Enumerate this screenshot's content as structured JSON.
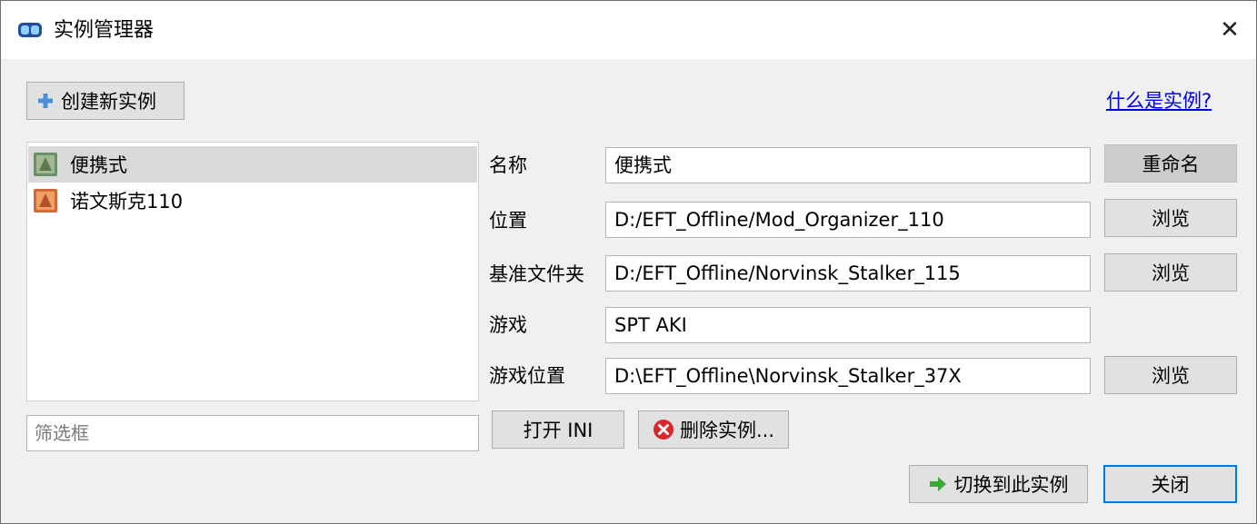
{
  "window": {
    "title": "实例管理器",
    "close_glyph": "✕"
  },
  "toolbar": {
    "create_label": "创建新实例",
    "help_link": "什么是实例?"
  },
  "instances": [
    {
      "name": "便携式",
      "selected": true
    },
    {
      "name": "诺文斯克110",
      "selected": false
    }
  ],
  "filter": {
    "placeholder": "筛选框",
    "value": ""
  },
  "form": {
    "name_label": "名称",
    "name_value": "便携式",
    "rename_label": "重命名",
    "location_label": "位置",
    "location_value": "D:/EFT_Offline/Mod_Organizer_110",
    "base_dir_label": "基准文件夹",
    "base_dir_value": "D:/EFT_Offline/Norvinsk_Stalker_115",
    "game_label": "游戏",
    "game_value": "SPT AKI",
    "game_location_label": "游戏位置",
    "game_location_value": "D:\\EFT_Offline\\Norvinsk_Stalker_37X",
    "browse_label": "浏览"
  },
  "actions": {
    "open_ini_label": "打开 INI",
    "delete_label": "删除实例...",
    "switch_label": "切换到此实例",
    "close_label": "关闭"
  },
  "colors": {
    "accent": "#0078d7",
    "link": "#0000ee",
    "selection": "#d9d9d9",
    "delete_icon": "#d9262c",
    "switch_icon": "#3aa935",
    "create_icon": "#4a90d9"
  },
  "icons": {
    "app": "mod-organizer-icon",
    "create": "plus-icon",
    "delete": "delete-icon",
    "switch": "arrow-right-icon",
    "close": "close-icon"
  }
}
